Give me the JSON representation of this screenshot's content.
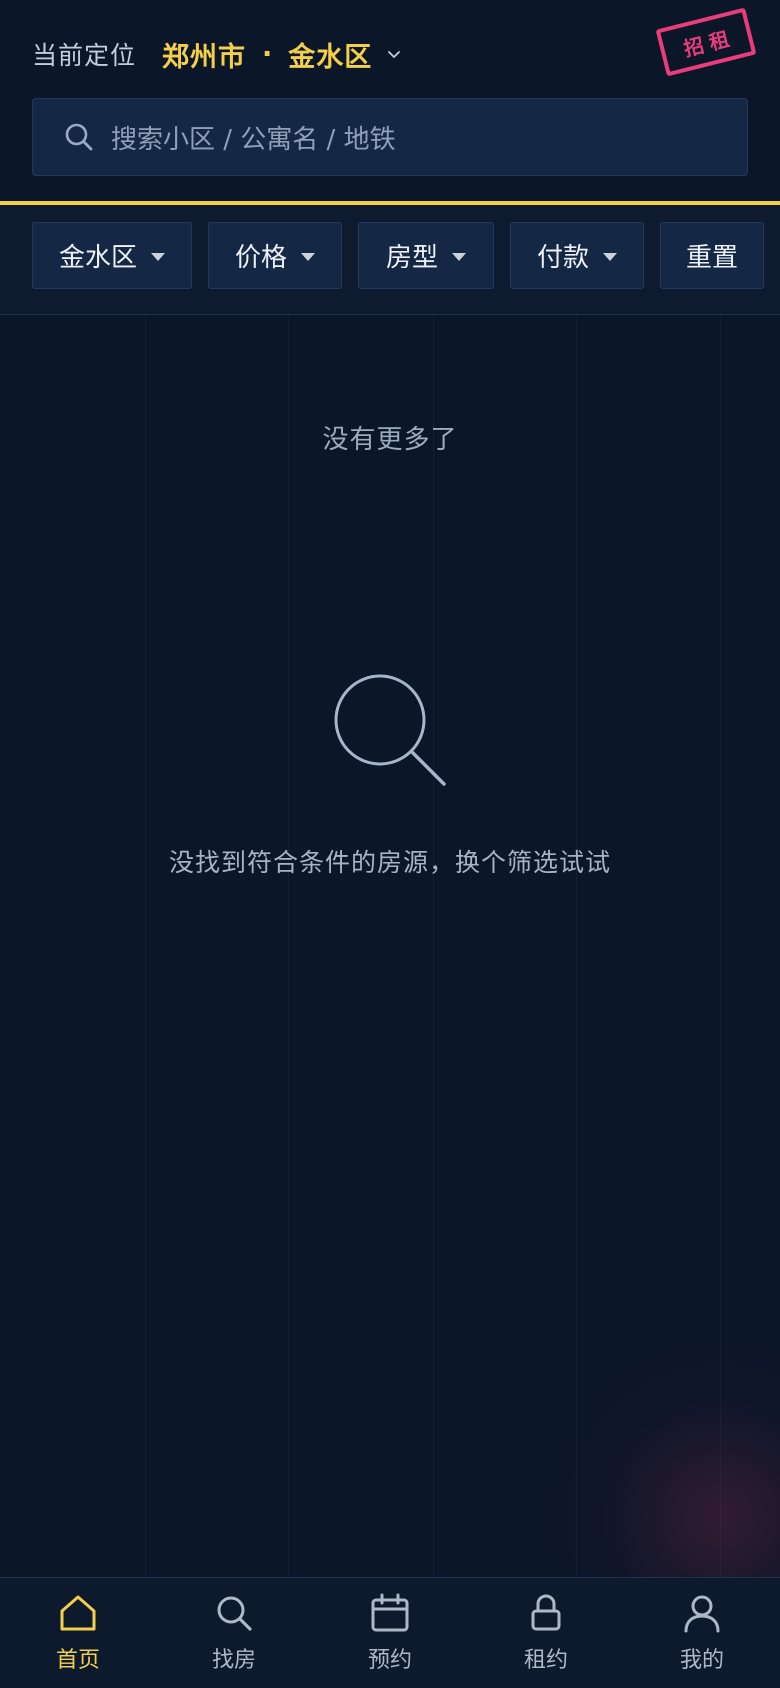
{
  "header": {
    "location_label": "当前定位",
    "city": "郑州市",
    "separator": "·",
    "district": "金水区",
    "stamp_text": "招租"
  },
  "search": {
    "placeholder": "搜索小区 / 公寓名 / 地铁"
  },
  "filters": [
    {
      "label": "金水区",
      "has_dropdown": true
    },
    {
      "label": "价格",
      "has_dropdown": true
    },
    {
      "label": "房型",
      "has_dropdown": true
    },
    {
      "label": "付款",
      "has_dropdown": true
    },
    {
      "label": "重置",
      "has_dropdown": false
    }
  ],
  "content": {
    "no_more_text": "没有更多了",
    "empty_icon": "search-icon",
    "empty_text": "没找到符合条件的房源，换个筛选试试"
  },
  "tabbar": {
    "items": [
      {
        "label": "首页",
        "icon": "home-icon",
        "active": true
      },
      {
        "label": "找房",
        "icon": "search-icon",
        "active": false
      },
      {
        "label": "预约",
        "icon": "calendar-icon",
        "active": false
      },
      {
        "label": "租约",
        "icon": "lock-icon",
        "active": false
      },
      {
        "label": "我的",
        "icon": "user-icon",
        "active": false
      }
    ]
  },
  "colors": {
    "background": "#0b1628",
    "accent": "#f3cf4a",
    "stamp": "#e83c7c",
    "panel": "#142744"
  }
}
